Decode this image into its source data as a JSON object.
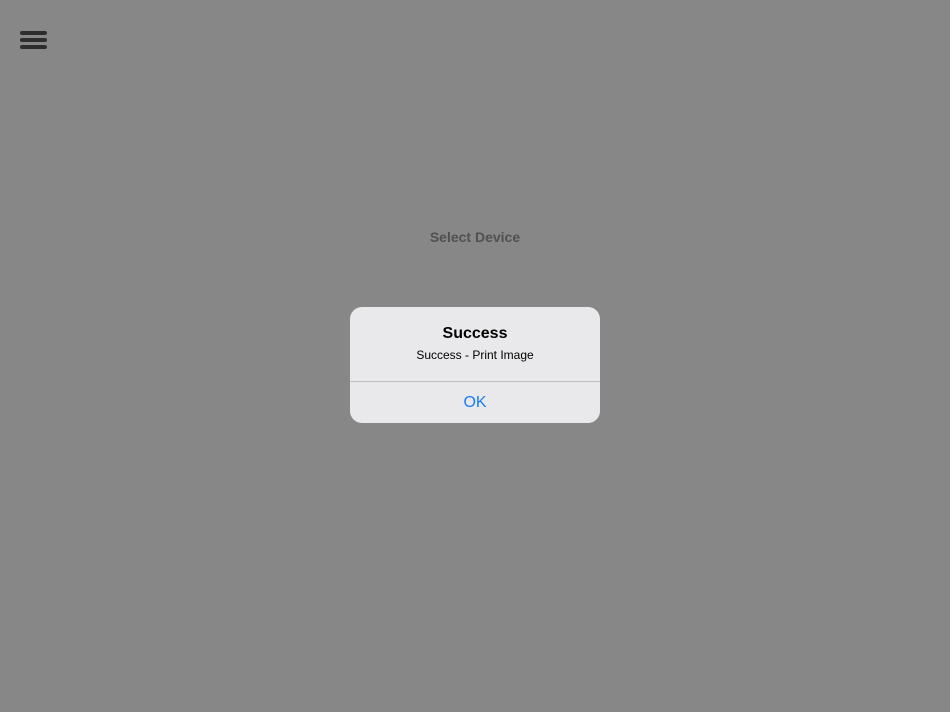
{
  "header": {
    "menu_icon": "hamburger-menu-icon"
  },
  "main": {
    "select_device_label": "Select Device"
  },
  "alert": {
    "title": "Success",
    "message": "Success - Print Image",
    "ok_label": "OK"
  },
  "colors": {
    "overlay": "#878787",
    "alert_background": "#e4e4e6",
    "accent": "#1a7cf5",
    "menu_icon": "#555555"
  }
}
